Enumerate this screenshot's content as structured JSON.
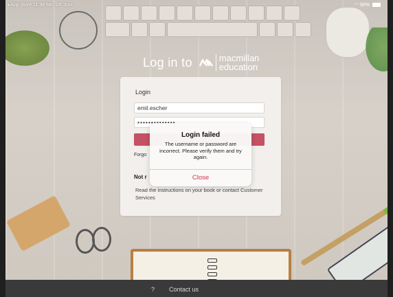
{
  "status_bar": {
    "left_text": "◂ App Store  11:38  Mo. 24. Juni",
    "right_text": "90%"
  },
  "heading": {
    "text": "Log in to",
    "brand_line1": "macmillan",
    "brand_line2": "education"
  },
  "login_card": {
    "label": "Login",
    "username_value": "emil.escher",
    "password_value": "••••••••••••••",
    "forgot_text": "Forgo",
    "not_registered_text": "Not r",
    "instructions": "Read the instructions on your book or contact Customer Services"
  },
  "alert": {
    "title": "Login failed",
    "message": "The username or password are incorrect. Please verify them and try again.",
    "close_label": "Close"
  },
  "footer": {
    "help_label": "?",
    "contact_label": "Contact us"
  },
  "colors": {
    "accent": "#c45263",
    "close_text": "#d0314a",
    "footer_bg": "#3a3a3a"
  }
}
